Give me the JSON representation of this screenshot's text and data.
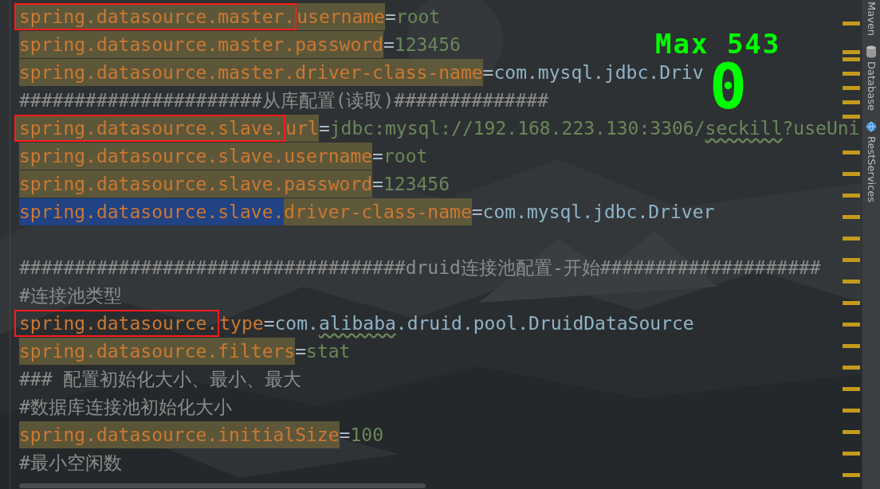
{
  "editor": {
    "lines": [
      {
        "kind": "code",
        "segments": [
          {
            "kind": "key",
            "text": "spring.datasource.master.",
            "boxed": true,
            "highlighted": true
          },
          {
            "kind": "key",
            "text": "username",
            "highlighted": true
          },
          {
            "kind": "sep",
            "text": "="
          },
          {
            "kind": "string",
            "text": "root"
          }
        ]
      },
      {
        "kind": "code",
        "segments": [
          {
            "kind": "key",
            "text": "spring.datasource.master.password",
            "highlighted": true
          },
          {
            "kind": "sep",
            "text": "="
          },
          {
            "kind": "string",
            "text": "123456"
          }
        ]
      },
      {
        "kind": "code",
        "segments": [
          {
            "kind": "key",
            "text": "spring.datasource.master.driver-class-name",
            "highlighted": true
          },
          {
            "kind": "sep",
            "text": "="
          },
          {
            "kind": "class",
            "text": "com.mysql.jdbc.Driv"
          }
        ]
      },
      {
        "kind": "code",
        "segments": [
          {
            "kind": "comment",
            "text": "######################从库配置(读取)##############"
          }
        ]
      },
      {
        "kind": "code",
        "segments": [
          {
            "kind": "key",
            "text": "spring.datasource.slave.",
            "boxed": true,
            "highlighted": true
          },
          {
            "kind": "key",
            "text": "url",
            "highlighted": true
          },
          {
            "kind": "sep",
            "text": "="
          },
          {
            "kind": "string",
            "text": "jdbc:mysql://192.168.223.130:3306/"
          },
          {
            "kind": "string",
            "text": "seckill",
            "typo": true
          },
          {
            "kind": "string",
            "text": "?useUni"
          }
        ]
      },
      {
        "kind": "code",
        "segments": [
          {
            "kind": "key",
            "text": "spring.datasource.slave.username",
            "highlighted": true
          },
          {
            "kind": "sep",
            "text": "="
          },
          {
            "kind": "string",
            "text": "root"
          }
        ]
      },
      {
        "kind": "code",
        "segments": [
          {
            "kind": "key",
            "text": "spring.datasource.slave.password",
            "highlighted": true
          },
          {
            "kind": "sep",
            "text": "="
          },
          {
            "kind": "string",
            "text": "123456"
          }
        ]
      },
      {
        "kind": "code",
        "segments": [
          {
            "kind": "key",
            "text": "spring.datasource.slave.",
            "selected": true
          },
          {
            "kind": "key",
            "text": "driver-class-name",
            "highlighted": true
          },
          {
            "kind": "sep",
            "text": "="
          },
          {
            "kind": "class",
            "text": "com.mysql.jdbc.Driver"
          }
        ]
      },
      {
        "kind": "blank"
      },
      {
        "kind": "code",
        "segments": [
          {
            "kind": "comment",
            "text": "###################################druid连接池配置-开始####################"
          }
        ]
      },
      {
        "kind": "code",
        "segments": [
          {
            "kind": "comment",
            "text": "#连接池类型"
          }
        ]
      },
      {
        "kind": "code",
        "segments": [
          {
            "kind": "key",
            "text": "spring.datasource.",
            "boxed": true
          },
          {
            "kind": "key",
            "text": "type"
          },
          {
            "kind": "sep",
            "text": "="
          },
          {
            "kind": "class",
            "text": "com."
          },
          {
            "kind": "class",
            "text": "alibaba",
            "typo": true
          },
          {
            "kind": "class",
            "text": ".druid.pool.DruidDataSource"
          }
        ]
      },
      {
        "kind": "code",
        "segments": [
          {
            "kind": "key",
            "text": "spring.datasource.filters",
            "highlighted": true
          },
          {
            "kind": "sep",
            "text": "="
          },
          {
            "kind": "string",
            "text": "stat"
          }
        ]
      },
      {
        "kind": "code",
        "segments": [
          {
            "kind": "comment",
            "text": "### 配置初始化大小、最小、最大"
          }
        ]
      },
      {
        "kind": "code",
        "segments": [
          {
            "kind": "comment",
            "text": "#数据库连接池初始化大小"
          }
        ]
      },
      {
        "kind": "code",
        "segments": [
          {
            "kind": "key",
            "text": "spring.datasource.initialSize",
            "highlighted": true
          },
          {
            "kind": "sep",
            "text": "="
          },
          {
            "kind": "string",
            "text": "100"
          }
        ]
      },
      {
        "kind": "code",
        "segments": [
          {
            "kind": "comment",
            "text": "#最小空闲数"
          }
        ]
      }
    ]
  },
  "overlay": {
    "max_label": "Max 543",
    "counter": "0"
  },
  "tool_strip": [
    {
      "label": "Maven",
      "kind": "plain"
    },
    {
      "label": "Database",
      "kind": "database"
    },
    {
      "label": "RestServices",
      "kind": "service"
    }
  ]
}
